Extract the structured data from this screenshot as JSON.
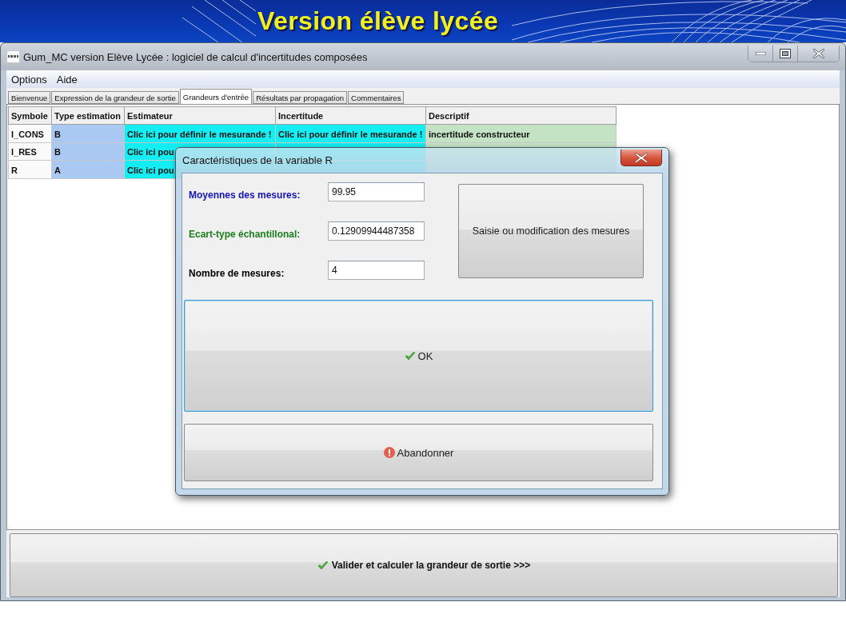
{
  "banner": {
    "title": "Version élève lycée"
  },
  "window": {
    "title": "Gum_MC version Elève Lycée : logiciel de calcul d'incertitudes composées"
  },
  "menu": [
    {
      "label": "Options"
    },
    {
      "label": "Aide"
    }
  ],
  "tabs": [
    {
      "label": "Bienvenue",
      "selected": false
    },
    {
      "label": "Expression de la grandeur de sortie",
      "selected": false
    },
    {
      "label": "Grandeurs d'entrée",
      "selected": true
    },
    {
      "label": "Résultats par propagation",
      "selected": false
    },
    {
      "label": "Commentaires",
      "selected": false
    }
  ],
  "table": {
    "columns": [
      "Symbole",
      "Type estimation",
      "Estimateur",
      "Incertitude",
      "Descriptif"
    ],
    "rows": [
      {
        "cells": [
          "I_CONS",
          "B",
          "Clic ici pour définir le mesurande !",
          "Clic ici pour définir le mesurande !",
          "incertitude constructeur"
        ]
      },
      {
        "cells": [
          "I_RES",
          "B",
          "Clic ici pou"
        ]
      },
      {
        "cells": [
          "R",
          "A",
          "Clic ici pou"
        ]
      }
    ]
  },
  "dialog": {
    "title": "Caractéristiques de la variable R",
    "fields": [
      {
        "label": "Moyennes des mesures:",
        "value": "99.95",
        "color": "#1414b8"
      },
      {
        "label": "Ecart-type échantillonal:",
        "value": "0.12909944487358",
        "color": "#1e7d1e"
      },
      {
        "label": "Nombre de mesures:",
        "value": "4",
        "color": "#000000"
      }
    ],
    "measures_button": "Saisie ou modification des mesures",
    "buttons": [
      {
        "kind": "confirm",
        "label": "OK",
        "focused": true
      },
      {
        "kind": "cancel",
        "label": "Abandonner",
        "focused": false
      }
    ]
  },
  "action_button": {
    "label": "Valider et calculer la grandeur de sortie >>>"
  }
}
